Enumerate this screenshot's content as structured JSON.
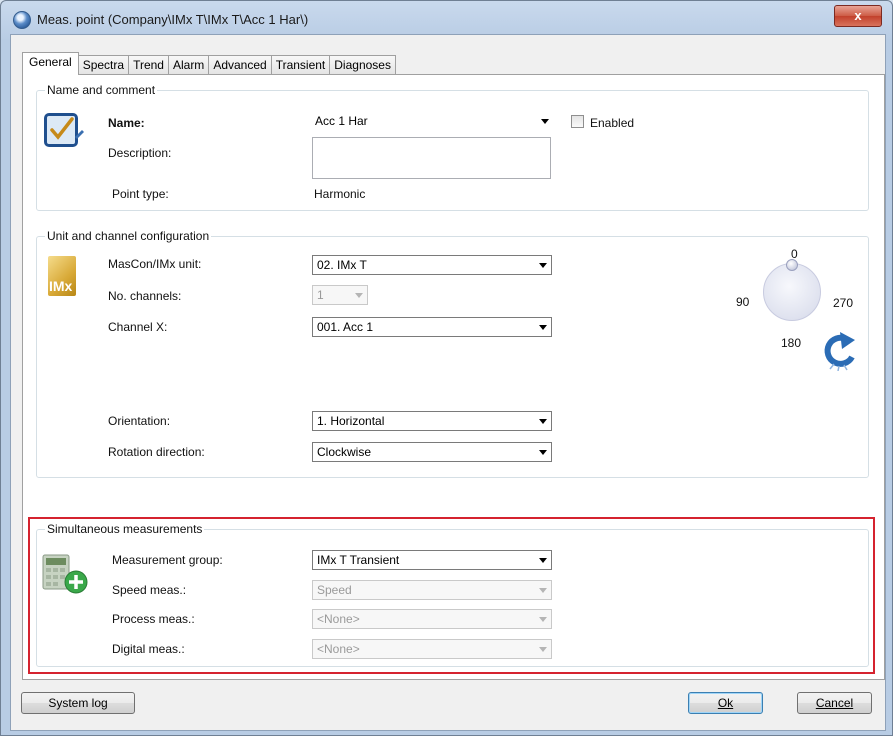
{
  "window": {
    "title": "Meas. point (Company\\IMx T\\IMx T\\Acc 1 Har\\)",
    "close_label": "x"
  },
  "tabs": [
    "General",
    "Spectra",
    "Trend",
    "Alarm",
    "Advanced",
    "Transient",
    "Diagnoses"
  ],
  "name_and_comment": {
    "legend": "Name and comment",
    "name_label": "Name:",
    "name_value": "Acc 1 Har",
    "enabled_label": "Enabled",
    "enabled_checked": false,
    "description_label": "Description:",
    "description_value": "",
    "point_type_label": "Point type:",
    "point_type_value": "Harmonic"
  },
  "unit_channel": {
    "legend": "Unit and channel configuration",
    "icon_text": "IMx",
    "unit_label": "MasCon/IMx unit:",
    "unit_value": "02. IMx T",
    "channels_label": "No. channels:",
    "channels_value": "1",
    "channel_x_label": "Channel X:",
    "channel_x_value": "001. Acc 1",
    "orientation_label": "Orientation:",
    "orientation_value": "1. Horizontal",
    "rotation_label": "Rotation direction:",
    "rotation_value": "Clockwise",
    "dial": {
      "top": "0",
      "left": "90",
      "right": "270",
      "bottom": "180"
    }
  },
  "simultaneous": {
    "legend": "Simultaneous measurements",
    "group_label": "Measurement group:",
    "group_value": "IMx T Transient",
    "speed_label": "Speed meas.:",
    "speed_value": "Speed",
    "process_label": "Process meas.:",
    "process_value": "<None>",
    "digital_label": "Digital meas.:",
    "digital_value": "<None>"
  },
  "footer": {
    "system_log": "System log",
    "ok": "Ok",
    "cancel": "Cancel"
  },
  "colors": {
    "highlight": "#d5232f",
    "accent": "#2b6cb5"
  }
}
